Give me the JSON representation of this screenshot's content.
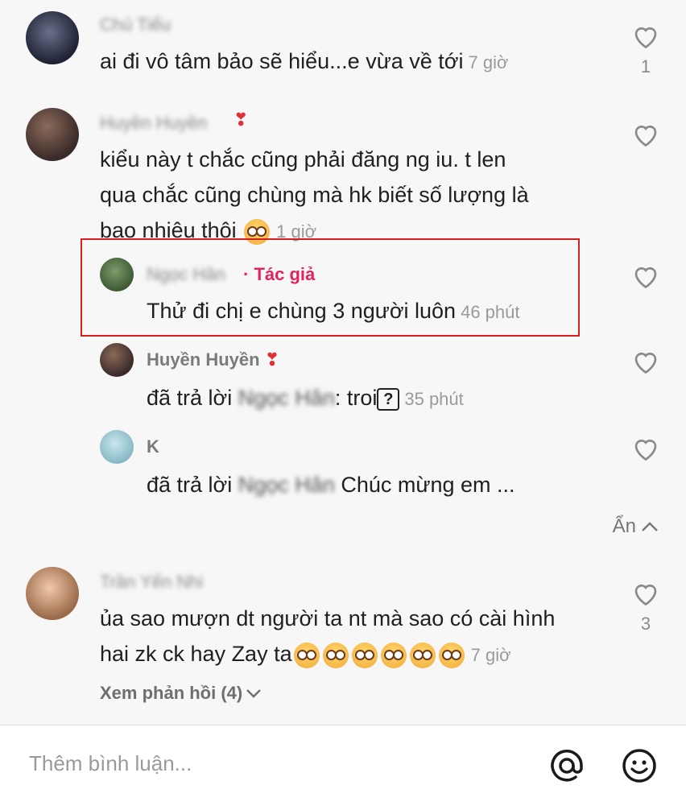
{
  "comments": [
    {
      "username": "Chú Tiểu",
      "text": "ai đi vô tâm bảo sẽ hiểu...e vừa về tới",
      "time": "7 giờ",
      "likes": "1"
    },
    {
      "username": "Huyền Huyền",
      "line1": "kiểu này t chắc cũng phải đăng ng iu. t len",
      "line2": "qua chắc cũng chùng mà hk biết số lượng là",
      "line3": "bao nhiêu thôi",
      "time": "1 giờ"
    }
  ],
  "replies": [
    {
      "username": "Ngọc Hân",
      "badge": "· Tác giả",
      "text": "Thử đi chị e chùng 3 người luôn",
      "time": "46 phút"
    },
    {
      "username": "Huyền Huyền",
      "prefix": "đã trả lời",
      "mention": "Ngọc Hân",
      "text": ": troi",
      "qmark": "?",
      "time": "35 phút"
    },
    {
      "username": "K",
      "prefix": "đã trả lời",
      "mention": "Ngọc Hân",
      "text": " Chúc mừng em ..."
    }
  ],
  "hide_label": "Ẩn",
  "comment3": {
    "username": "Trần Yến Nhi",
    "line1": "ủa sao mượn dt người ta nt mà sao có cài hình",
    "line2": "hai zk ck hay Zay ta",
    "time": "7 giờ",
    "likes": "3",
    "view_replies": "Xem phản hồi (4)"
  },
  "input": {
    "placeholder": "Thêm bình luận..."
  },
  "colors": {
    "author_badge": "#e0245e",
    "highlight_box": "#d62020"
  }
}
